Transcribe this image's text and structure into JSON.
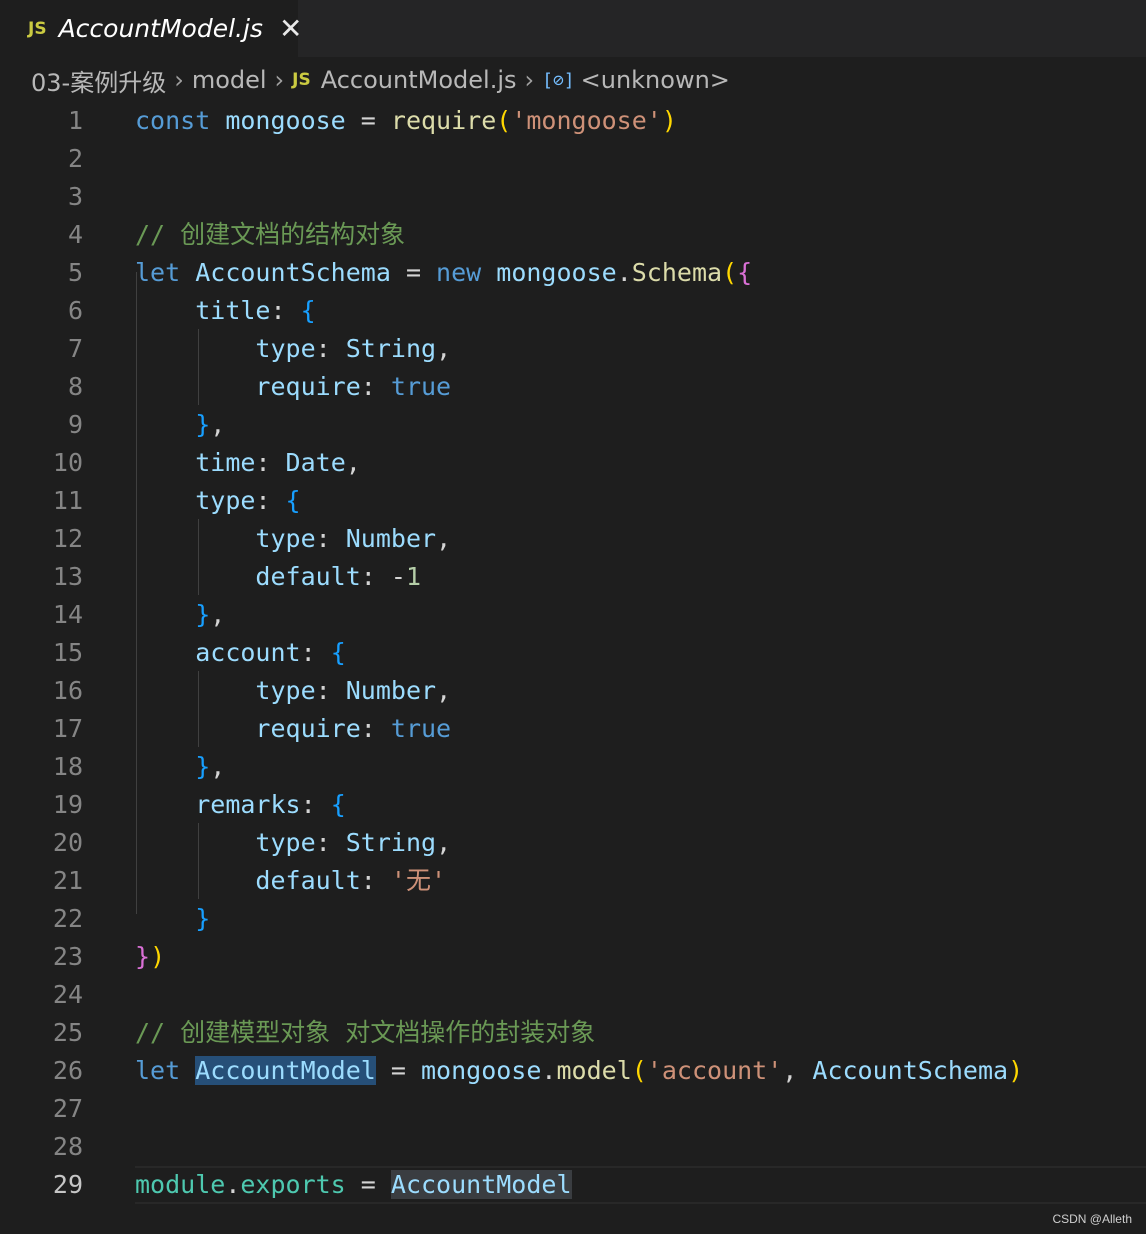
{
  "tab": {
    "badge": "JS",
    "title": "AccountModel.js",
    "close": "✕"
  },
  "breadcrumb": {
    "items": [
      "03-案例升级",
      "model",
      "AccountModel.js",
      "<unknown>"
    ],
    "separator": "›",
    "file_badge": "JS",
    "symbol_icon": "[⊘]"
  },
  "editor": {
    "active_line": 29,
    "lines": [
      [
        {
          "t": "const",
          "c": "kw"
        },
        {
          "t": " ",
          "c": "op"
        },
        {
          "t": "mongoose",
          "c": "var"
        },
        {
          "t": " = ",
          "c": "op"
        },
        {
          "t": "require",
          "c": "fn"
        },
        {
          "t": "(",
          "c": "b1"
        },
        {
          "t": "'mongoose'",
          "c": "str"
        },
        {
          "t": ")",
          "c": "b1"
        }
      ],
      [],
      [],
      [
        {
          "t": "// 创建文档的结构对象",
          "c": "cmt"
        }
      ],
      [
        {
          "t": "let",
          "c": "kw"
        },
        {
          "t": " ",
          "c": "op"
        },
        {
          "t": "AccountSchema",
          "c": "var"
        },
        {
          "t": " = ",
          "c": "op"
        },
        {
          "t": "new",
          "c": "kw"
        },
        {
          "t": " ",
          "c": "op"
        },
        {
          "t": "mongoose",
          "c": "var"
        },
        {
          "t": ".",
          "c": "pun"
        },
        {
          "t": "Schema",
          "c": "fn"
        },
        {
          "t": "(",
          "c": "b1"
        },
        {
          "t": "{",
          "c": "b2"
        }
      ],
      [
        {
          "t": "    ",
          "c": "op"
        },
        {
          "t": "title",
          "c": "var"
        },
        {
          "t": ": ",
          "c": "op"
        },
        {
          "t": "{",
          "c": "b3"
        }
      ],
      [
        {
          "t": "        ",
          "c": "op"
        },
        {
          "t": "type",
          "c": "var"
        },
        {
          "t": ": ",
          "c": "op"
        },
        {
          "t": "String",
          "c": "var"
        },
        {
          "t": ",",
          "c": "pun"
        }
      ],
      [
        {
          "t": "        ",
          "c": "op"
        },
        {
          "t": "require",
          "c": "var"
        },
        {
          "t": ": ",
          "c": "op"
        },
        {
          "t": "true",
          "c": "kw"
        }
      ],
      [
        {
          "t": "    ",
          "c": "op"
        },
        {
          "t": "}",
          "c": "b3"
        },
        {
          "t": ",",
          "c": "pun"
        }
      ],
      [
        {
          "t": "    ",
          "c": "op"
        },
        {
          "t": "time",
          "c": "var"
        },
        {
          "t": ": ",
          "c": "op"
        },
        {
          "t": "Date",
          "c": "var"
        },
        {
          "t": ",",
          "c": "pun"
        }
      ],
      [
        {
          "t": "    ",
          "c": "op"
        },
        {
          "t": "type",
          "c": "var"
        },
        {
          "t": ": ",
          "c": "op"
        },
        {
          "t": "{",
          "c": "b3"
        }
      ],
      [
        {
          "t": "        ",
          "c": "op"
        },
        {
          "t": "type",
          "c": "var"
        },
        {
          "t": ": ",
          "c": "op"
        },
        {
          "t": "Number",
          "c": "var"
        },
        {
          "t": ",",
          "c": "pun"
        }
      ],
      [
        {
          "t": "        ",
          "c": "op"
        },
        {
          "t": "default",
          "c": "var"
        },
        {
          "t": ": ",
          "c": "op"
        },
        {
          "t": "-",
          "c": "op"
        },
        {
          "t": "1",
          "c": "num"
        }
      ],
      [
        {
          "t": "    ",
          "c": "op"
        },
        {
          "t": "}",
          "c": "b3"
        },
        {
          "t": ",",
          "c": "pun"
        }
      ],
      [
        {
          "t": "    ",
          "c": "op"
        },
        {
          "t": "account",
          "c": "var"
        },
        {
          "t": ": ",
          "c": "op"
        },
        {
          "t": "{",
          "c": "b3"
        }
      ],
      [
        {
          "t": "        ",
          "c": "op"
        },
        {
          "t": "type",
          "c": "var"
        },
        {
          "t": ": ",
          "c": "op"
        },
        {
          "t": "Number",
          "c": "var"
        },
        {
          "t": ",",
          "c": "pun"
        }
      ],
      [
        {
          "t": "        ",
          "c": "op"
        },
        {
          "t": "require",
          "c": "var"
        },
        {
          "t": ": ",
          "c": "op"
        },
        {
          "t": "true",
          "c": "kw"
        }
      ],
      [
        {
          "t": "    ",
          "c": "op"
        },
        {
          "t": "}",
          "c": "b3"
        },
        {
          "t": ",",
          "c": "pun"
        }
      ],
      [
        {
          "t": "    ",
          "c": "op"
        },
        {
          "t": "remarks",
          "c": "var"
        },
        {
          "t": ": ",
          "c": "op"
        },
        {
          "t": "{",
          "c": "b3"
        }
      ],
      [
        {
          "t": "        ",
          "c": "op"
        },
        {
          "t": "type",
          "c": "var"
        },
        {
          "t": ": ",
          "c": "op"
        },
        {
          "t": "String",
          "c": "var"
        },
        {
          "t": ",",
          "c": "pun"
        }
      ],
      [
        {
          "t": "        ",
          "c": "op"
        },
        {
          "t": "default",
          "c": "var"
        },
        {
          "t": ": ",
          "c": "op"
        },
        {
          "t": "'无'",
          "c": "str"
        }
      ],
      [
        {
          "t": "    ",
          "c": "op"
        },
        {
          "t": "}",
          "c": "b3"
        }
      ],
      [
        {
          "t": "}",
          "c": "b2"
        },
        {
          "t": ")",
          "c": "b1"
        }
      ],
      [],
      [
        {
          "t": "// 创建模型对象 对文档操作的封装对象",
          "c": "cmt"
        }
      ],
      [
        {
          "t": "let",
          "c": "kw"
        },
        {
          "t": " ",
          "c": "op"
        },
        {
          "t": "AccountModel",
          "c": "var hl1"
        },
        {
          "t": " = ",
          "c": "op"
        },
        {
          "t": "mongoose",
          "c": "var"
        },
        {
          "t": ".",
          "c": "pun"
        },
        {
          "t": "model",
          "c": "fn"
        },
        {
          "t": "(",
          "c": "b1"
        },
        {
          "t": "'account'",
          "c": "str"
        },
        {
          "t": ", ",
          "c": "pun"
        },
        {
          "t": "AccountSchema",
          "c": "var"
        },
        {
          "t": ")",
          "c": "b1"
        }
      ],
      [],
      [],
      [
        {
          "t": "module",
          "c": "cls"
        },
        {
          "t": ".",
          "c": "pun"
        },
        {
          "t": "exports",
          "c": "cls"
        },
        {
          "t": " = ",
          "c": "op"
        },
        {
          "t": "AccountModel",
          "c": "var hl2"
        }
      ]
    ]
  },
  "watermark": "CSDN @Alleth"
}
